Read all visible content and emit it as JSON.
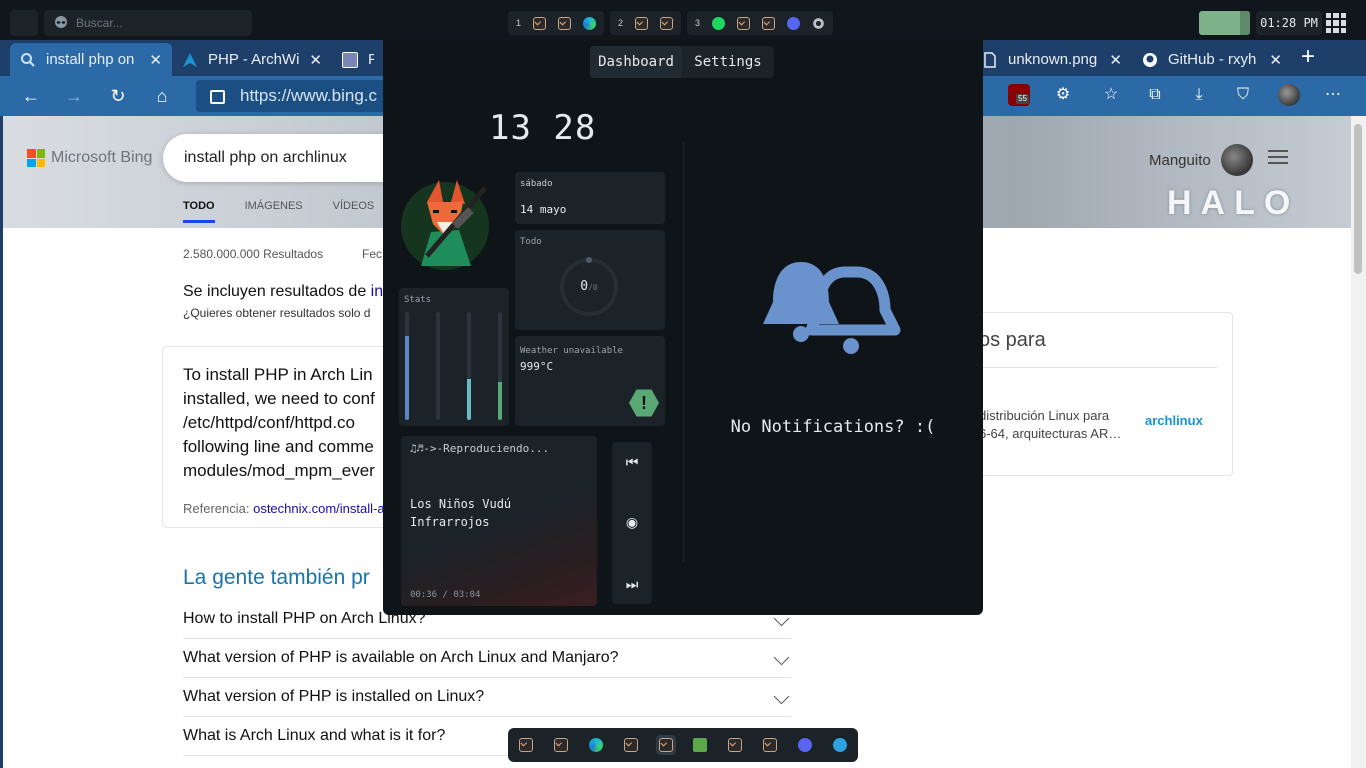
{
  "topbar": {
    "search_placeholder": "Buscar...",
    "workspaces": [
      {
        "number": "1",
        "icons": [
          "terminal-icon",
          "terminal-icon",
          "edge-icon"
        ]
      },
      {
        "number": "2",
        "icons": [
          "terminal-icon",
          "terminal-icon"
        ]
      },
      {
        "number": "3",
        "icons": [
          "spotify-icon",
          "terminal-icon",
          "terminal-icon",
          "discord-icon",
          "settings-icon"
        ]
      }
    ],
    "clock": "01:28 PM"
  },
  "browser": {
    "tabs": [
      {
        "label": "install php on",
        "active": true,
        "favicon": "search-icon"
      },
      {
        "label": "PHP - ArchWi",
        "active": false,
        "favicon": "arch-icon"
      },
      {
        "label": "PH",
        "active": false,
        "favicon": "php-icon"
      },
      {
        "label": "unknown.png",
        "active": false,
        "favicon": "file-icon"
      },
      {
        "label": "GitHub - rxyh",
        "active": false,
        "favicon": "github-icon"
      }
    ],
    "url": "https://www.bing.c",
    "extension_badge": "55"
  },
  "bing": {
    "logo": "Microsoft Bing",
    "query": "install php on archlinux",
    "tabs": [
      "TODO",
      "IMÁGENES",
      "VÍDEOS"
    ],
    "user": "Manguito",
    "hero_text": "HALO",
    "results_count": "2.580.000.000 Resultados",
    "filter": "Fec",
    "included_prefix": "Se incluyen resultados de ",
    "included_link": "ins",
    "ask_original": "¿Quieres obtener resultados solo d",
    "answer_lines": "To install PHP in Arch Lin\ninstalled, we need to conf\n/etc/httpd/conf/httpd.co\nfollowing line and comme\nmodules/mod_mpm_ever",
    "reference_label": "Referencia: ",
    "reference_link": "ostechnix.com/install-a",
    "people_also_ask": "La gente también pr",
    "faq": [
      "How to install PHP on Arch Linux?",
      "What version of PHP is available on Arch Linux and Manjaro?",
      "What version of PHP is installed on Linux?",
      "What is Arch Linux and what is it for?"
    ],
    "side_heading": "os para",
    "side_desc": "distribución Linux para\n6-64, arquitecturas AR…",
    "side_logo": "archlinux"
  },
  "dashboard": {
    "tabs": [
      "Dashboard",
      "Settings"
    ],
    "clock": "13 28",
    "day": "sábado",
    "date": "14 mayo",
    "todo_title": "Todo",
    "todo_count": "0",
    "todo_total": "/0",
    "stats_title": "Stats",
    "stats_levels": [
      0.78,
      0.0,
      0.38,
      0.35
    ],
    "stats_colors": [
      "#5a88c4",
      "#4b3c5a",
      "#6ab8c8",
      "#5aa876"
    ],
    "weather_status": "Weather unavailable",
    "temperature": "999°C",
    "music_status": "♫♬->-Reproduciendo...",
    "song_title": "Los Niños Vudú",
    "song_artist": "Infrarrojos",
    "music_time": "00:36 / 03:04",
    "notification_text": "No Notifications? :("
  },
  "dock": {
    "apps": [
      "terminal-icon",
      "terminal-icon",
      "edge-icon",
      "terminal-icon",
      "terminal-icon",
      "game-icon",
      "terminal-icon",
      "terminal-icon",
      "discord-icon",
      "telegram-icon"
    ],
    "active_index": 4
  }
}
